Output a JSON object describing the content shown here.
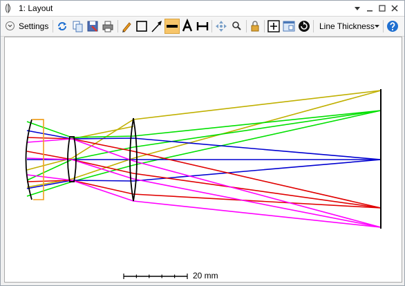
{
  "window": {
    "title": "1: Layout"
  },
  "toolbar": {
    "settings_label": "Settings",
    "line_thickness_label": "Line Thickness",
    "icons": [
      "refresh-icon",
      "copy-icon",
      "save-icon",
      "print-icon",
      "pencil-icon",
      "rectangle-icon",
      "arrow-icon",
      "line-icon",
      "text-icon",
      "dimension-icon",
      "pan-icon",
      "zoom-icon",
      "lock-icon",
      "fit-icon",
      "window-icon",
      "rotate-icon",
      "help-icon"
    ]
  },
  "plot": {
    "scale_bar_label": "20 mm"
  },
  "colors": {
    "ray_blue": "#0000d0",
    "ray_green": "#00e000",
    "ray_yellow": "#c0b000",
    "ray_red": "#e00000",
    "ray_magenta": "#ff00ff",
    "lens_outline": "#000000",
    "orange_element": "#f0a020",
    "active_tool": "#f7c56a"
  }
}
